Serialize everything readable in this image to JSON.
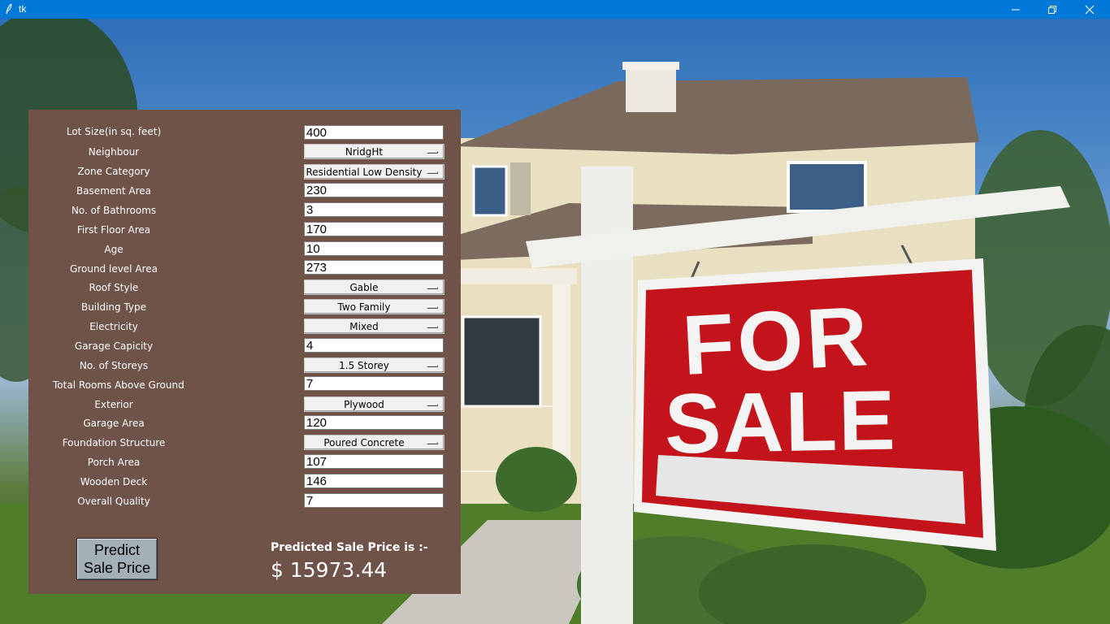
{
  "window": {
    "title": "tk",
    "minimize_icon": "minimize-icon",
    "maximize_icon": "restore-icon",
    "close_icon": "close-icon"
  },
  "background": {
    "sign_line1": "FOR",
    "sign_line2": "SALE",
    "sign_color": "#c4141b"
  },
  "form": {
    "fields": [
      {
        "label": "Lot Size(in sq. feet)",
        "type": "entry",
        "value": "400"
      },
      {
        "label": "Neighbour",
        "type": "option",
        "value": "NridgHt"
      },
      {
        "label": "Zone Category",
        "type": "option",
        "value": "Residential Low Density"
      },
      {
        "label": "Basement Area",
        "type": "entry",
        "value": "230"
      },
      {
        "label": "No. of Bathrooms",
        "type": "entry",
        "value": "3"
      },
      {
        "label": "First Floor Area",
        "type": "entry",
        "value": "170"
      },
      {
        "label": "Age",
        "type": "entry",
        "value": "10"
      },
      {
        "label": "Ground level Area",
        "type": "entry",
        "value": "273"
      },
      {
        "label": "Roof Style",
        "type": "option",
        "value": "Gable"
      },
      {
        "label": "Building Type",
        "type": "option",
        "value": "Two Family"
      },
      {
        "label": "Electricity",
        "type": "option",
        "value": "Mixed"
      },
      {
        "label": "Garage Capicity",
        "type": "entry",
        "value": "4"
      },
      {
        "label": "No. of Storeys",
        "type": "option",
        "value": "1.5 Storey"
      },
      {
        "label": "Total Rooms Above Ground",
        "type": "entry",
        "value": "7"
      },
      {
        "label": "Exterior",
        "type": "option",
        "value": "Plywood"
      },
      {
        "label": "Garage Area",
        "type": "entry",
        "value": "120"
      },
      {
        "label": "Foundation Structure",
        "type": "option",
        "value": "Poured Concrete"
      },
      {
        "label": "Porch Area",
        "type": "entry",
        "value": "107"
      },
      {
        "label": "Wooden Deck",
        "type": "entry",
        "value": "146"
      },
      {
        "label": "Overall Quality",
        "type": "entry",
        "value": "7"
      }
    ],
    "predict_button": {
      "line1": "Predict",
      "line2": "Sale Price"
    },
    "result": {
      "label": "Predicted Sale Price is :-",
      "value": "$ 15973.44"
    },
    "panel_color": "#6f5349"
  }
}
